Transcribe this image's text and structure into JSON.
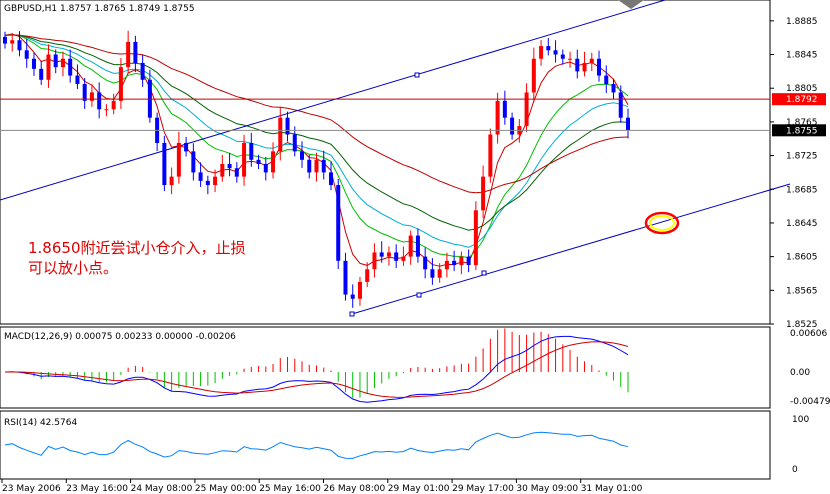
{
  "symbol_title": "GBPUSD,H1  1.8757 1.8765 1.8749 1.8755",
  "annotation": {
    "line1": "1.8650附近尝试小仓介入，止损",
    "line2": "可以放小点。"
  },
  "colors": {
    "bull": "#ff0000",
    "bear": "#0000ff",
    "ma_red": "#d00000",
    "ma_green": "#00c000",
    "ma_cyan": "#00b0d0",
    "ma_darkgreen": "#006000",
    "ma_maroon": "#c00000",
    "trend_line": "#0000c0",
    "price_tag_red": "#ff0000"
  },
  "price_axis": {
    "ticks": [
      "1.8885",
      "1.8845",
      "1.8805",
      "1.8765",
      "1.8725",
      "1.8685",
      "1.8645",
      "1.8605",
      "1.8565",
      "1.8525"
    ],
    "tags": [
      {
        "value": "1.8792",
        "color": "#ff0000",
        "text_color": "#ffffff"
      },
      {
        "value": "1.8755",
        "color": "#000000",
        "text_color": "#ffffff"
      }
    ]
  },
  "time_axis": {
    "labels": [
      "23 May 2006",
      "23 May 16:00",
      "24 May 08:00",
      "25 May 00:00",
      "25 May 16:00",
      "26 May 08:00",
      "29 May 01:00",
      "29 May 17:00",
      "30 May 09:00",
      "31 May 01:00"
    ]
  },
  "macd": {
    "title": "MACD(12,26,9) 0.00075 0.00233 0.00000 -0.00206",
    "ticks": [
      "0.00606",
      "0.00",
      "-0.00479"
    ]
  },
  "rsi": {
    "title": "RSI(14) 42.5764",
    "ticks": [
      "100",
      "0"
    ]
  },
  "chart_data": {
    "type": "line",
    "series": [
      {
        "values": [
          1.8858,
          1.8862,
          1.885,
          1.884,
          1.8828,
          1.8815,
          1.8845,
          1.883,
          1.884,
          1.882,
          1.881,
          1.879,
          1.88,
          1.878,
          1.878,
          1.879,
          1.883,
          1.886,
          1.8835,
          1.8815,
          1.877,
          1.874,
          1.869,
          1.87,
          1.874,
          1.873,
          1.8705,
          1.8695,
          1.869,
          1.87,
          1.8715,
          1.871,
          1.87,
          1.874,
          1.872,
          1.8715,
          1.8705,
          1.873,
          1.877,
          1.875,
          1.873,
          1.872,
          1.8705,
          1.872,
          1.8705,
          1.869,
          1.86,
          1.856,
          1.8555,
          1.8575,
          1.859,
          1.861,
          1.8605,
          1.861,
          1.86,
          1.8605,
          1.863,
          1.8605,
          1.859,
          1.858,
          1.859,
          1.86,
          1.8595,
          1.8605,
          1.8595,
          1.866,
          1.87,
          1.875,
          1.879,
          1.877,
          1.875,
          1.876,
          1.88,
          1.884,
          1.8855,
          1.885,
          1.8845,
          1.884,
          1.884,
          1.8825,
          1.8835,
          1.884,
          1.882,
          1.881,
          1.88,
          1.877,
          1.8755
        ]
      }
    ],
    "ylim": [
      1.8525,
      1.8905
    ]
  }
}
